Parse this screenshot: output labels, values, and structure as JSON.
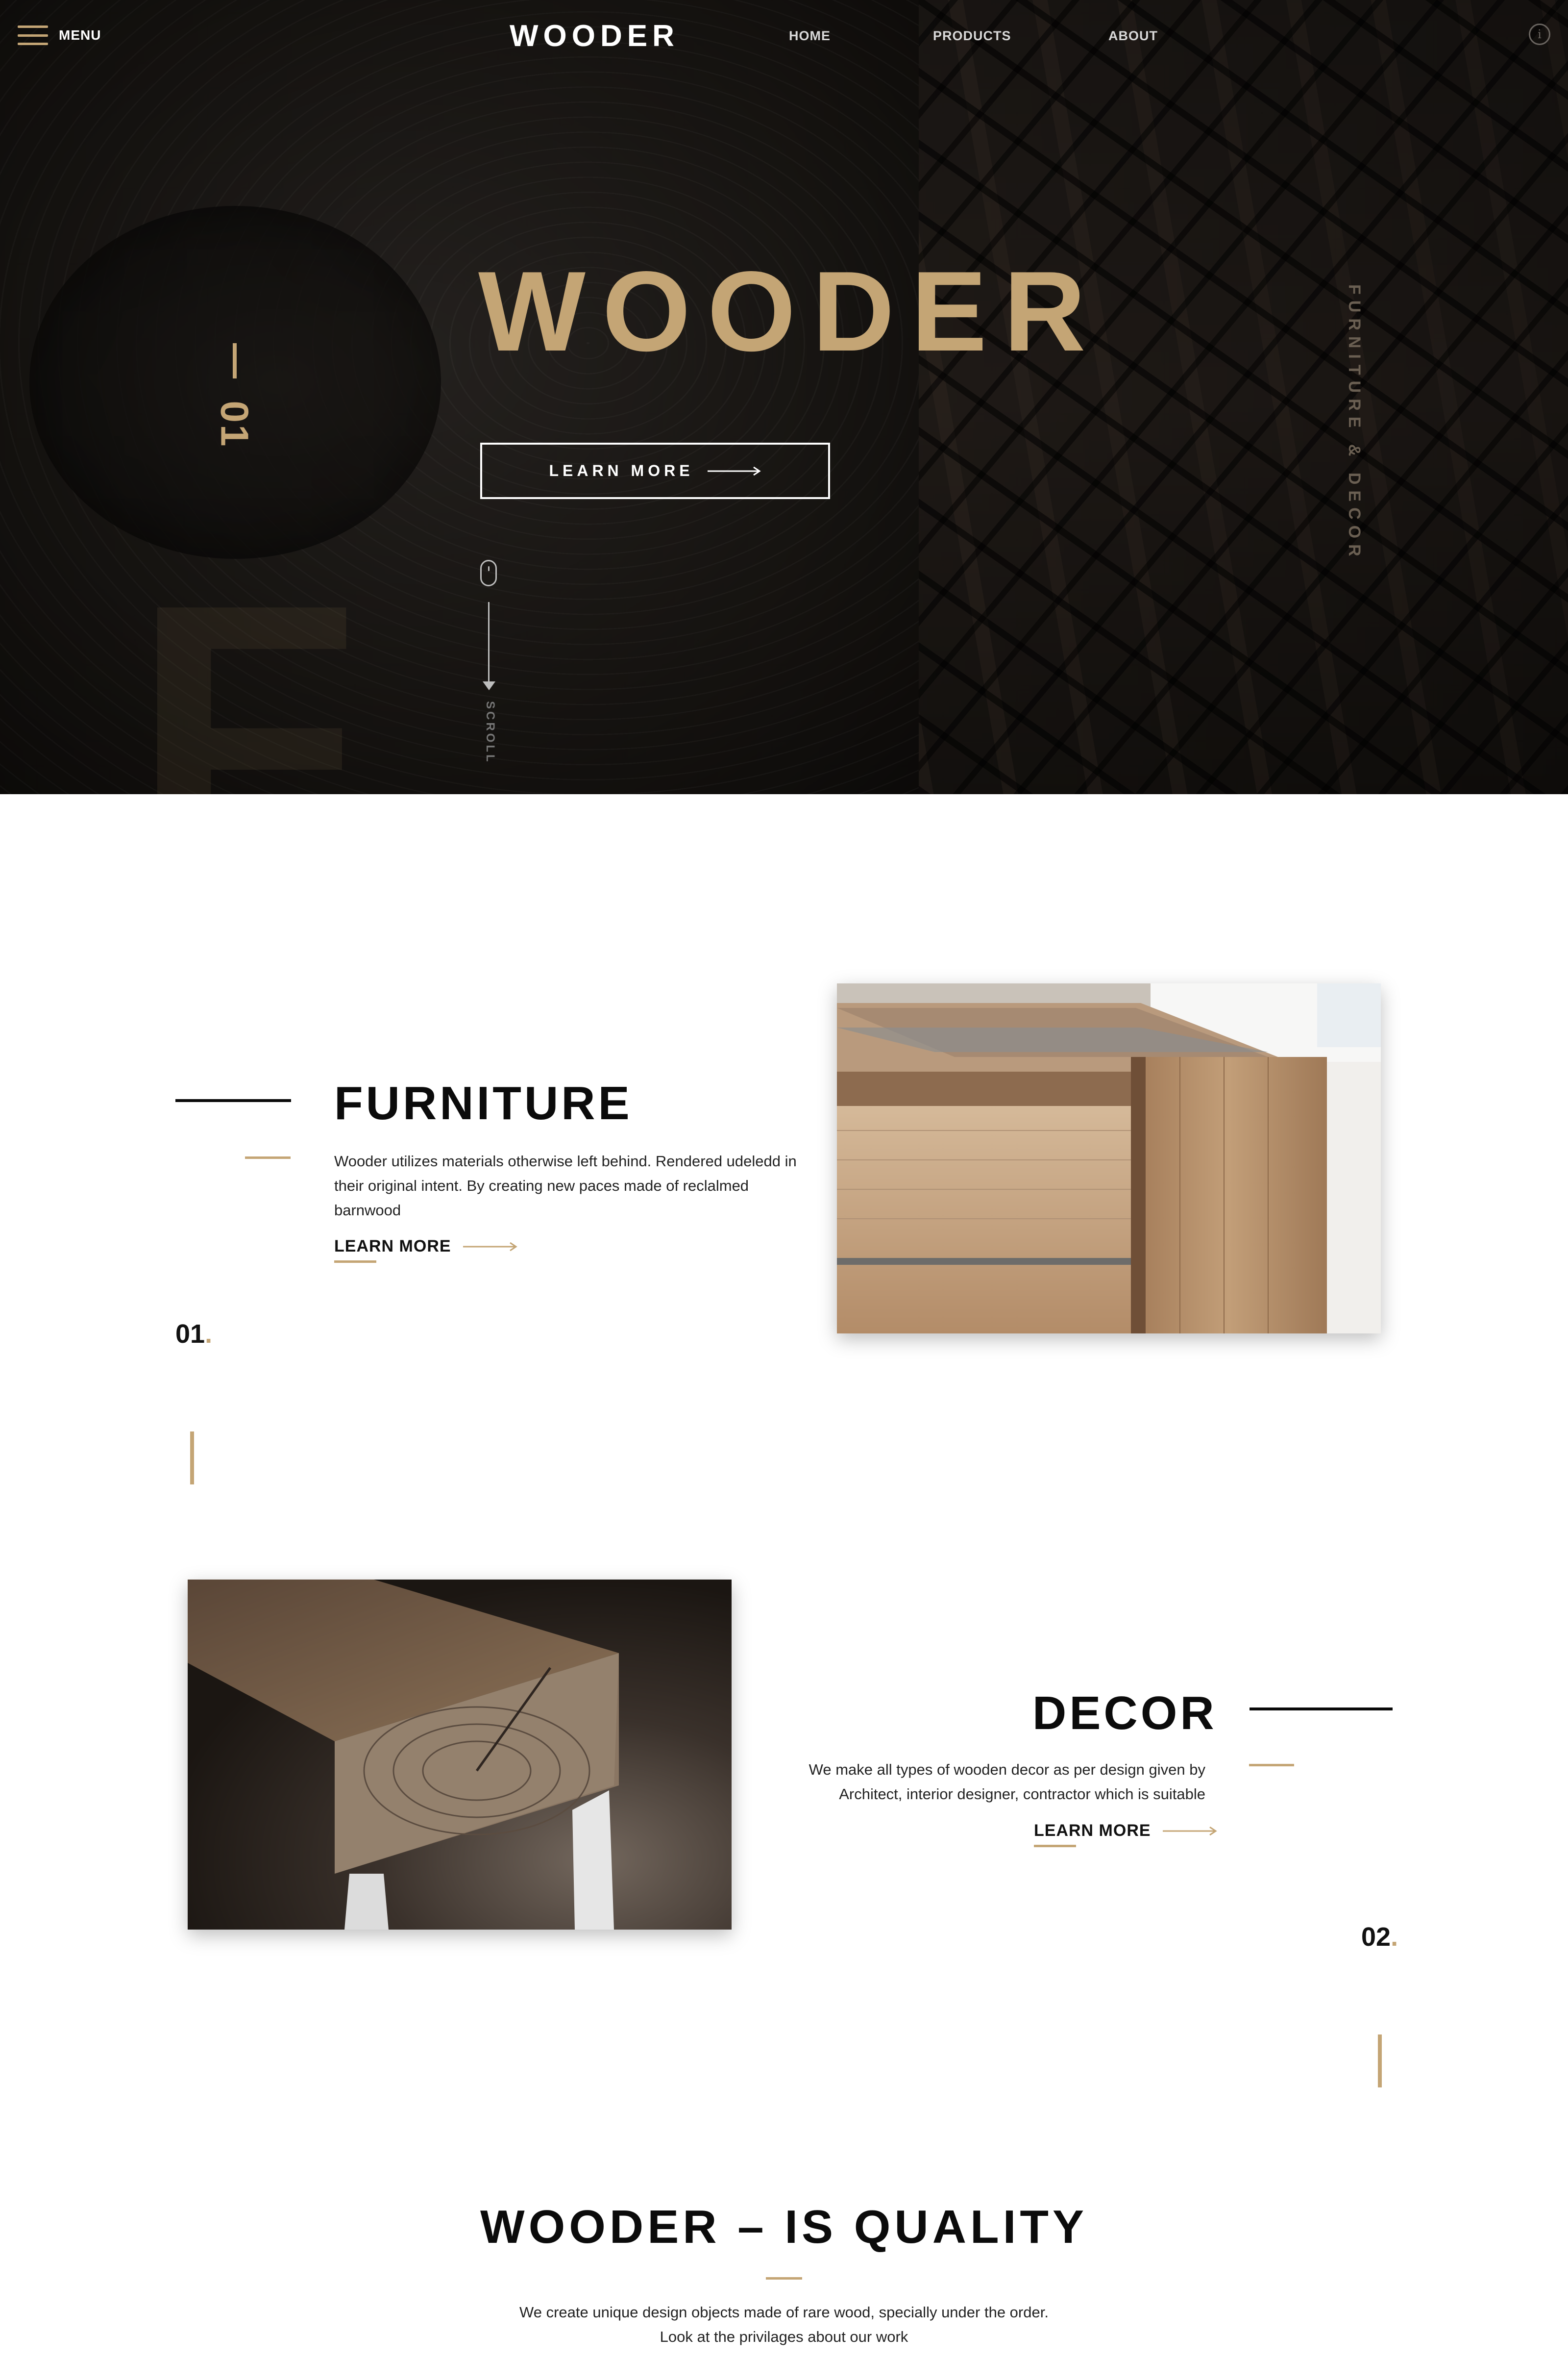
{
  "colors": {
    "accent": "#c4a575",
    "dark": "#0b0b0b",
    "hero_bg": "#16130f"
  },
  "nav": {
    "menu_label": "MENU",
    "logo": "WOODER",
    "links": [
      "HOME",
      "PRODUCTS",
      "ABOUT"
    ],
    "info_icon": "info-icon"
  },
  "hero": {
    "title": "WOODER",
    "button_label": "LEARN MORE",
    "slide_number": "01",
    "side_tag": "FURNITURE & DECOR",
    "scroll_label": "SCROLL",
    "big_letter": "F"
  },
  "sections": [
    {
      "title": "FURNITURE",
      "description": "Wooder utilizes materials otherwise left behind. Rendered udeledd in their original intent. By creating new paces made of reclalmed barnwood",
      "learn_more": "LEARN MORE",
      "number": "01",
      "image": "wooden-coffee-table-photo"
    },
    {
      "title": "DECOR",
      "description": "We make all types of wooden decor as per design given by Architect, interior designer, contractor which is suitable",
      "learn_more": "LEARN MORE",
      "number": "02",
      "image": "wooden-bench-photo"
    }
  ],
  "quality": {
    "title": "WOODER – IS QUALITY",
    "description_line1": "We create unique design objects made of rare wood, specially under the order.",
    "description_line2": "Look at the privilages about our work"
  }
}
